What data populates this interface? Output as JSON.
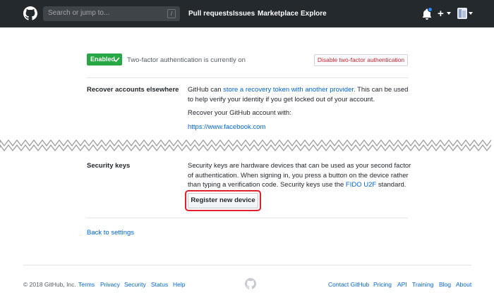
{
  "header": {
    "search_placeholder": "Search or jump to...",
    "search_shortcut": "/",
    "nav": [
      "Pull requests",
      "Issues",
      "Marketplace",
      "Explore"
    ],
    "plus_label": "+"
  },
  "two_factor": {
    "badge": "Enabled",
    "status": "Two-factor authentication is currently on",
    "disable_button": "Disable two-factor authentication"
  },
  "recover": {
    "title": "Recover accounts elsewhere",
    "text_before": "GitHub can ",
    "link": "store a recovery token with another provider",
    "text_after": ". This can be used to help verify your identity if you get locked out of your account.",
    "recover_with": "Recover your GitHub account with:",
    "provider_link": "https://www.facebook.com"
  },
  "security_keys": {
    "title": "Security keys",
    "text_before": "Security keys are hardware devices that can be used as your second factor of authentication. When signing in, you press a button on the device rather than typing a verification code. Security keys use the ",
    "link": "FIDO U2F",
    "text_after": " standard.",
    "register_button": "Register new device"
  },
  "back_link": "Back to settings",
  "footer": {
    "copyright": "© 2018 GitHub, Inc.",
    "left_links": [
      "Terms",
      "Privacy",
      "Security",
      "Status",
      "Help"
    ],
    "right_links": [
      "Contact GitHub",
      "Pricing",
      "API",
      "Training",
      "Blog",
      "About"
    ]
  },
  "colors": {
    "header_bg": "#24292e",
    "success": "#28a745",
    "danger": "#cb2431",
    "link": "#0366d6",
    "highlight": "#e0202b"
  }
}
